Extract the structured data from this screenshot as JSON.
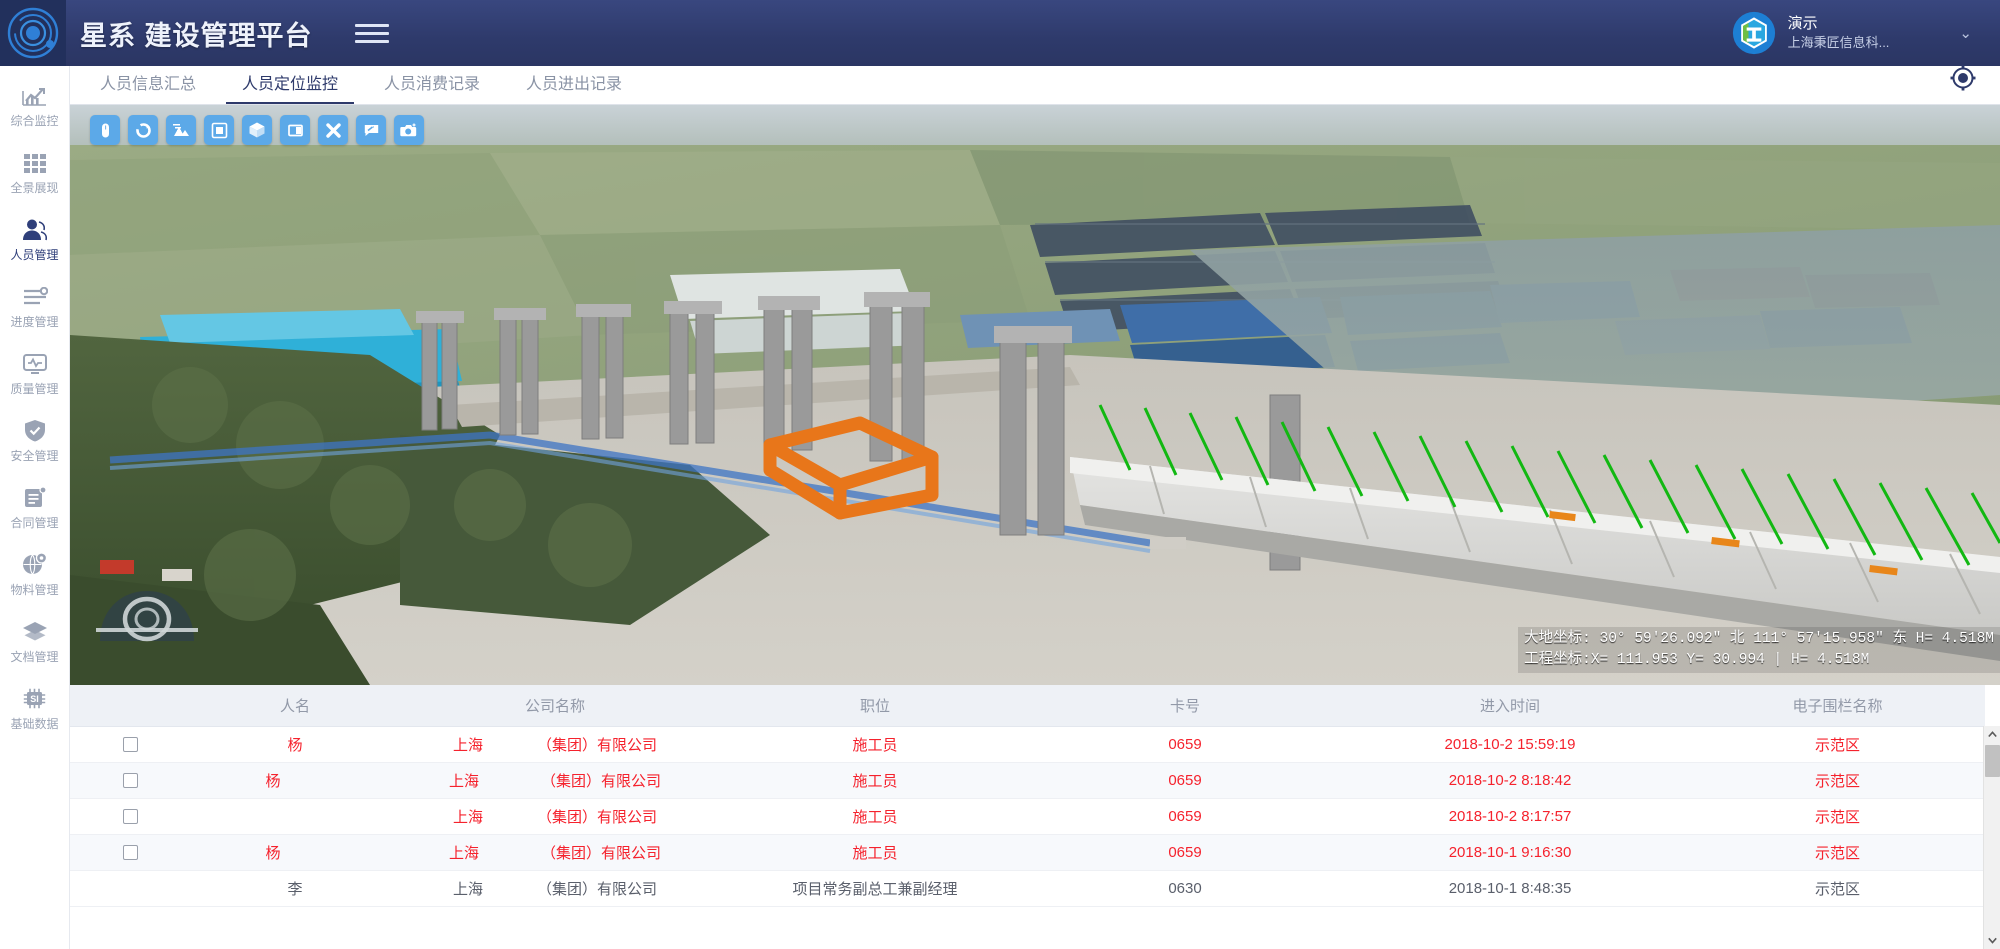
{
  "header": {
    "logo_icon": "orbit-logo-icon",
    "brand": "星系 建设管理平台",
    "menu_icon": "hamburger-menu-icon",
    "user": {
      "avatar_icon": "company-avatar-icon",
      "name": "演示",
      "org": "上海秉匠信息科...",
      "caret_icon": "chevron-down-icon"
    }
  },
  "sidebar": {
    "items": [
      {
        "label": "综合监控",
        "icon": "chart-trend-icon",
        "active": false
      },
      {
        "label": "全景展现",
        "icon": "grid-squares-icon",
        "active": false
      },
      {
        "label": "人员管理",
        "icon": "person-icon",
        "active": true
      },
      {
        "label": "进度管理",
        "icon": "sliders-icon",
        "active": false
      },
      {
        "label": "质量管理",
        "icon": "monitor-pulse-icon",
        "active": false
      },
      {
        "label": "安全管理",
        "icon": "shield-check-icon",
        "active": false
      },
      {
        "label": "合同管理",
        "icon": "contract-icon",
        "active": false
      },
      {
        "label": "物料管理",
        "icon": "globe-gear-icon",
        "active": false
      },
      {
        "label": "文档管理",
        "icon": "layers-icon",
        "active": false
      },
      {
        "label": "基础数据",
        "icon": "chip-si-icon",
        "active": false
      }
    ]
  },
  "tabs": {
    "items": [
      {
        "label": "人员信息汇总",
        "active": false
      },
      {
        "label": "人员定位监控",
        "active": true
      },
      {
        "label": "人员消费记录",
        "active": false
      },
      {
        "label": "人员进出记录",
        "active": false
      }
    ],
    "right_icon": "locate-target-icon"
  },
  "map": {
    "toolbar": [
      {
        "icon": "mouse-pointer-icon"
      },
      {
        "icon": "orbit-rotate-icon"
      },
      {
        "icon": "terrain-layers-icon"
      },
      {
        "icon": "select-box-icon"
      },
      {
        "icon": "cube-3d-icon"
      },
      {
        "icon": "section-split-icon"
      },
      {
        "icon": "close-cross-icon"
      },
      {
        "icon": "measure-edit-icon"
      },
      {
        "icon": "camera-snapshot-icon"
      }
    ],
    "compass_icon": "compass-navigation-icon",
    "geofence_color": "#E8761A",
    "coordinates": {
      "geodetic_line": "大地坐标: 30° 59′26.092″ 北  111° 57′15.958″ 东  H=  4.518M",
      "engineering_line": "工程坐标:X=       111.953  Y=        30.994 | H=  4.518M"
    }
  },
  "table": {
    "columns": [
      "",
      "人名",
      "公司名称",
      "职位",
      "卡号",
      "进入时间",
      "电子围栏名称"
    ],
    "rows": [
      {
        "checkbox": "",
        "name": "杨",
        "name_redact": 0,
        "company_pre": "上海",
        "company_redact": 0,
        "company_post": "（集团）有限公司",
        "position": "施工员",
        "card": "0659",
        "time": "2018-10-2 15:59:19",
        "fence": "示范区"
      },
      {
        "checkbox": "",
        "name": "杨",
        "name_redact": 44,
        "company_pre": "上海",
        "company_redact": 62,
        "company_post": "（集团）有限公司",
        "position": "施工员",
        "card": "0659",
        "time": "2018-10-2 8:18:42",
        "fence": "示范区"
      },
      {
        "checkbox": "",
        "name": "",
        "name_redact": 0,
        "company_pre": "上海",
        "company_redact": 0,
        "company_post": "（集团）有限公司",
        "position": "施工员",
        "card": "0659",
        "time": "2018-10-2 8:17:57",
        "fence": "示范区"
      },
      {
        "checkbox": "",
        "name": "杨",
        "name_redact": 44,
        "company_pre": "上海",
        "company_redact": 62,
        "company_post": "（集团）有限公司",
        "position": "施工员",
        "card": "0659",
        "time": "2018-10-1 9:16:30",
        "fence": "示范区"
      },
      {
        "checkbox": "",
        "name": "李",
        "name_redact": 0,
        "company_pre": "上海",
        "company_redact": 0,
        "company_post": "（集团）有限公司",
        "position": "项目常务副总工兼副经理",
        "card": "0630",
        "time": "2018-10-1 8:48:35",
        "fence": "示范区"
      }
    ]
  },
  "scrollbar": {
    "up_icon": "chevron-up-icon",
    "down_icon": "chevron-down-icon",
    "thumb": "scroll-thumb"
  },
  "colors": {
    "brand_navy": "#2e3a6b",
    "tool_blue": "#5ca9e8",
    "row_red": "#f5222d",
    "header_grey": "#eef1f6"
  }
}
